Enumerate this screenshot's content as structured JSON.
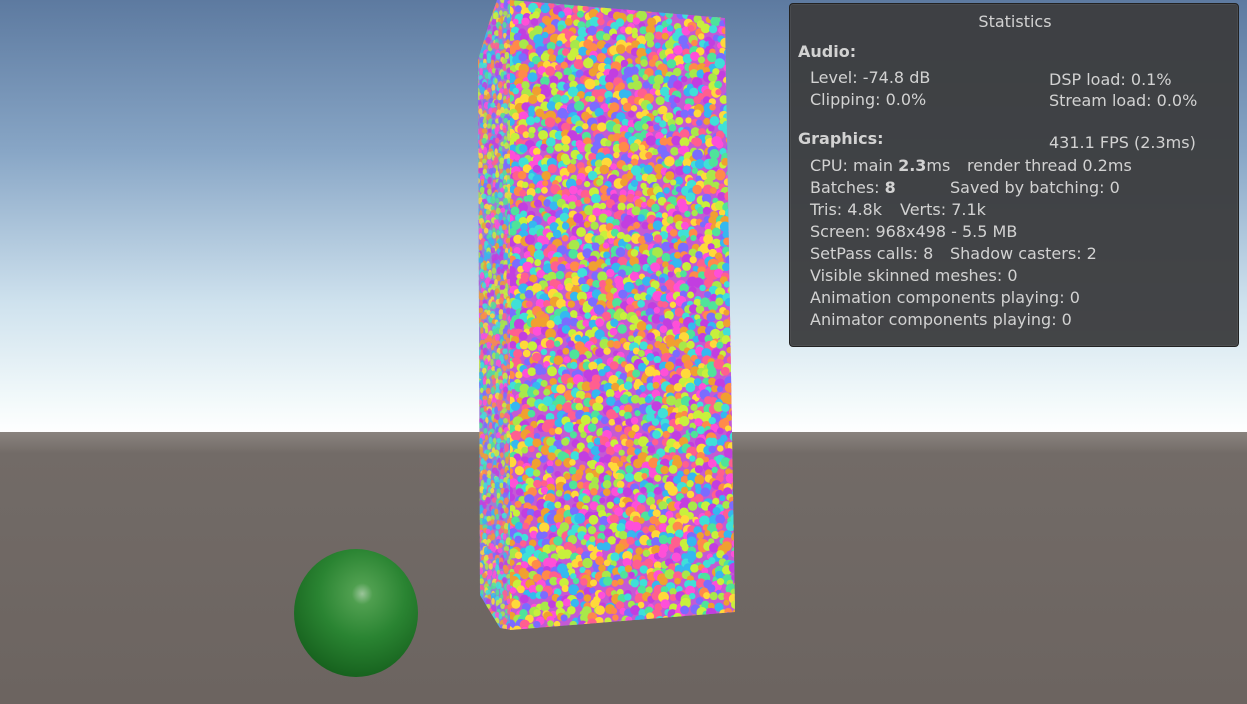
{
  "statistics": {
    "title": "Statistics",
    "audio": {
      "heading": "Audio:",
      "level": "Level: -74.8 dB",
      "dsp_load": "DSP load: 0.1%",
      "clipping": "Clipping: 0.0%",
      "stream_load": "Stream load: 0.0%"
    },
    "graphics": {
      "heading": "Graphics:",
      "fps": "431.1 FPS (2.3ms)",
      "cpu_prefix": "CPU: main ",
      "cpu_main": "2.3",
      "cpu_suffix": "ms",
      "render_thread": "render thread 0.2ms",
      "batches_label": "Batches: ",
      "batches_value": "8",
      "saved_by_batching": "Saved by batching: 0",
      "tris": "Tris: 4.8k",
      "verts": "Verts: 7.1k",
      "screen": "Screen: 968x498 - 5.5 MB",
      "setpass": "SetPass calls: 8",
      "shadow_casters": "Shadow casters: 2",
      "skinned": "Visible skinned meshes: 0",
      "animation": "Animation components playing: 0",
      "animator": "Animator components playing: 0"
    }
  },
  "scene": {
    "sky_top": "#5f7ba0",
    "sky_horizon": "#eef6f8",
    "ground": "#6c6561",
    "sphere_color": "#2a8a34"
  }
}
